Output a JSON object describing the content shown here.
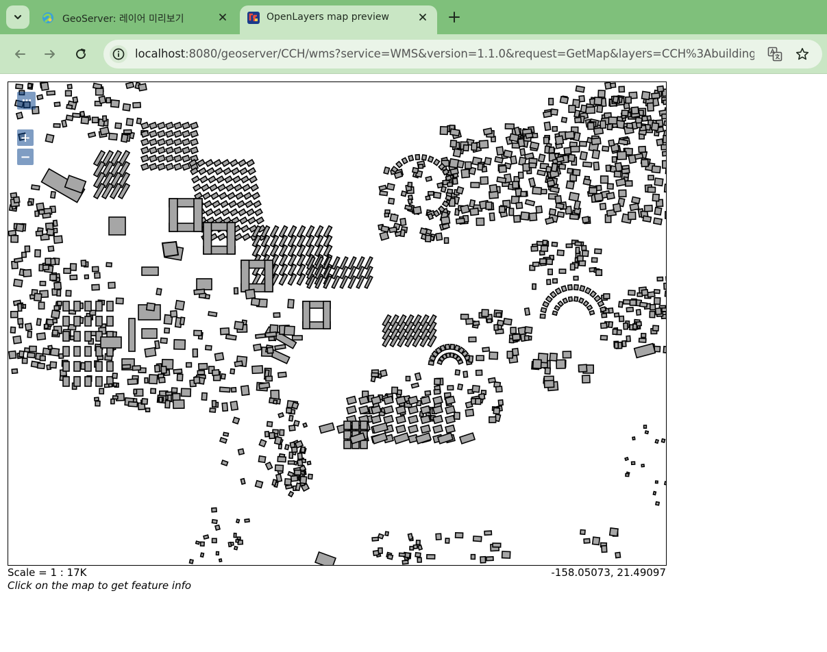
{
  "browser": {
    "tabs": [
      {
        "title": "GeoServer: 레이어 미리보기",
        "favicon": "geoserver-icon",
        "active": false
      },
      {
        "title": "OpenLayers map preview",
        "favicon": "openlayers-icon",
        "active": true
      }
    ],
    "address_bar": {
      "host": "localhost",
      "rest": ":8080/geoserver/CCH/wms?service=WMS&version=1.1.0&request=GetMap&layers=CCH%3Abuilding_f..."
    },
    "colors": {
      "tabstrip": "#7fc07b",
      "toolbar": "#c9e6c4",
      "omnibox": "#eaf4e8"
    }
  },
  "map": {
    "controls": {
      "toggle_label": "···",
      "zoom_in_label": "+",
      "zoom_out_label": "−"
    },
    "building_fill": "#a6a6a6",
    "building_stroke": "#000000"
  },
  "footer": {
    "scale": "Scale = 1 : 17K",
    "coordinates": "-158.05073, 21.49097",
    "hint": "Click on the map to get feature info"
  }
}
